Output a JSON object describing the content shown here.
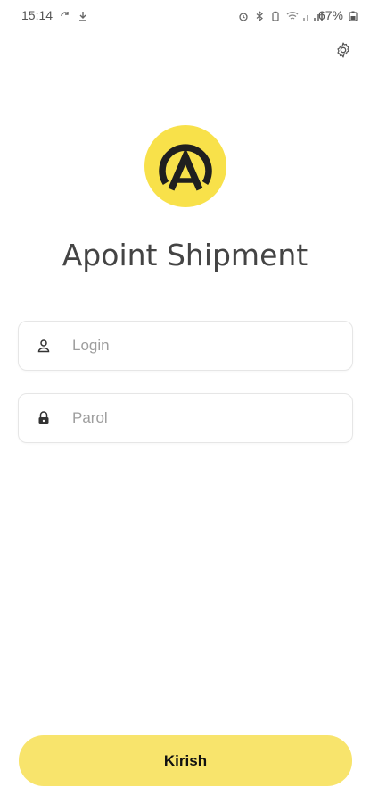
{
  "status_bar": {
    "time": "15:14",
    "battery": "67%",
    "left_icons": [
      "sync-icon",
      "download-icon"
    ],
    "right_icons": [
      "alarm-icon",
      "bluetooth-icon",
      "battery-saver-icon",
      "wifi-icon",
      "signal-icon",
      "battery-icon"
    ]
  },
  "header": {
    "settings_icon": "gear-icon"
  },
  "logo": {
    "background_color": "#f8e14a",
    "mark_color": "#1f1f1f"
  },
  "app": {
    "title": "Apoint Shipment"
  },
  "form": {
    "login": {
      "placeholder": "Login",
      "value": "",
      "icon": "user-icon"
    },
    "password": {
      "placeholder": "Parol",
      "value": "",
      "icon": "lock-icon"
    },
    "submit_label": "Kirish"
  },
  "colors": {
    "accent": "#f8e46c",
    "text": "#444444"
  }
}
